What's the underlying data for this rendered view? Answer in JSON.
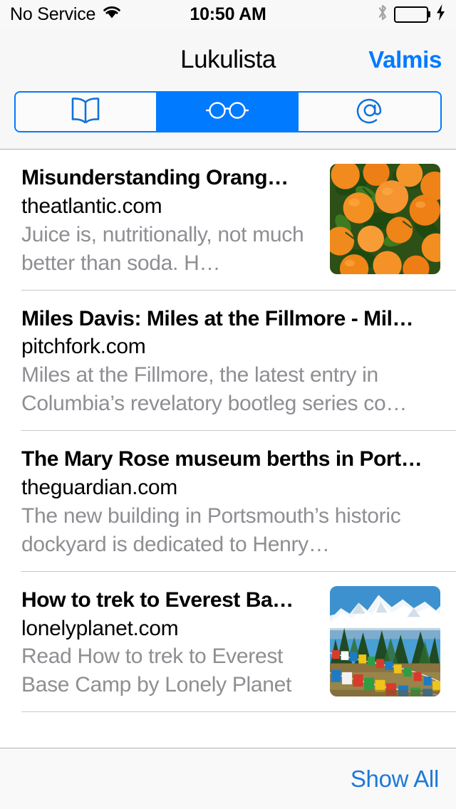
{
  "status_bar": {
    "carrier": "No Service",
    "wifi_icon": "wifi-icon",
    "time": "10:50 AM",
    "bluetooth_icon": "bluetooth-icon",
    "battery_icon": "battery-icon",
    "charging_icon": "lightning-bolt-icon",
    "battery_color": "#4cd964"
  },
  "nav": {
    "title": "Lukulista",
    "done_label": "Valmis",
    "accent_color": "#007aff"
  },
  "segmented_control": {
    "segments": [
      {
        "name": "bookmarks",
        "icon": "open-book-icon",
        "selected": false
      },
      {
        "name": "reading-list",
        "icon": "glasses-icon",
        "selected": true
      },
      {
        "name": "shared-links",
        "icon": "at-sign-icon",
        "selected": false
      }
    ],
    "selected_index": 1,
    "tint_color": "#007aff"
  },
  "list": {
    "items": [
      {
        "title": "Misunderstanding Orang…",
        "domain": "theatlantic.com",
        "snippet": "Juice is, nutritionally, not much better than soda. H…",
        "thumbnail": "oranges-photo",
        "has_thumbnail": true
      },
      {
        "title": "Miles Davis: Miles at the Fillmore - Mil…",
        "domain": "pitchfork.com",
        "snippet": "Miles at the Fillmore, the latest entry in Columbia’s revelatory bootleg series co…",
        "thumbnail": "",
        "has_thumbnail": false
      },
      {
        "title": "The Mary Rose museum berths in Port…",
        "domain": "theguardian.com",
        "snippet": "The new building in Portsmouth’s historic dockyard is dedicated to Henry…",
        "thumbnail": "",
        "has_thumbnail": false
      },
      {
        "title": "How to trek to Everest Ba…",
        "domain": "lonelyplanet.com",
        "snippet": "Read How to trek to Everest Base Camp by Lonely Planet",
        "thumbnail": "everest-prayer-flags-photo",
        "has_thumbnail": true
      }
    ]
  },
  "toolbar": {
    "show_all_label": "Show All",
    "link_color": "#1f78d8"
  }
}
